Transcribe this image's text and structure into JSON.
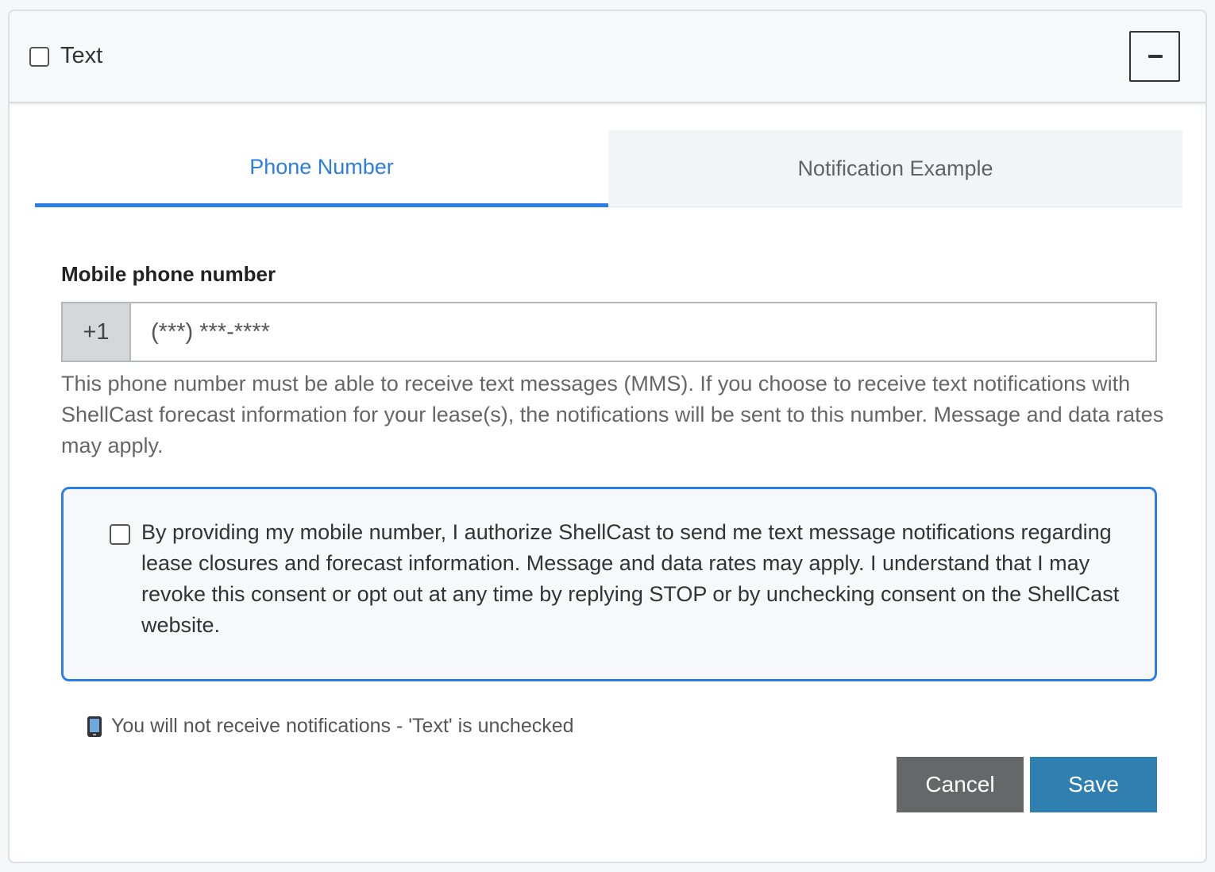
{
  "header": {
    "title": "Text",
    "checked": false,
    "collapse_icon": "minus-icon"
  },
  "tabs": [
    {
      "label": "Phone Number",
      "active": true
    },
    {
      "label": "Notification Example",
      "active": false
    }
  ],
  "phone": {
    "label": "Mobile phone number",
    "country_code": "+1",
    "placeholder": "(***) ***-****",
    "value": "",
    "help_text": "This phone number must be able to receive text messages (MMS). If you choose to receive text notifications with ShellCast forecast information for your lease(s), the notifications will be sent to this number. Message and data rates may apply."
  },
  "consent": {
    "checked": false,
    "text": "By providing my mobile number, I authorize ShellCast to send me text message notifications regarding lease closures and forecast information. Message and data rates may apply. I understand that I may revoke this consent or opt out at any time by replying STOP or by unchecking consent on the ShellCast website."
  },
  "status": {
    "icon": "mobile-phone-icon",
    "text": "You will not receive notifications - 'Text' is unchecked"
  },
  "actions": {
    "cancel_label": "Cancel",
    "save_label": "Save"
  },
  "colors": {
    "accent": "#2d7de6",
    "save_button": "#2f7fb1",
    "cancel_button": "#666768"
  }
}
